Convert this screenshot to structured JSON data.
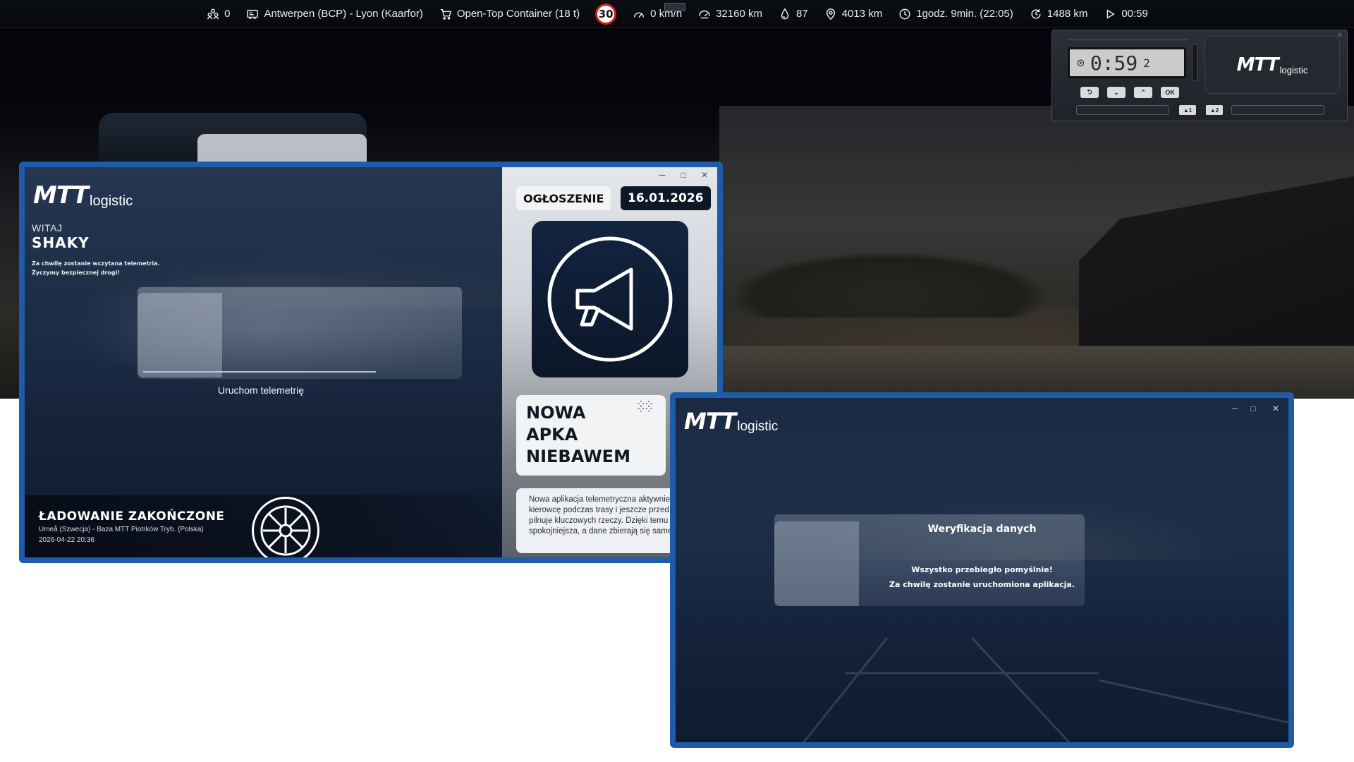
{
  "hud": {
    "convoy_count": "0",
    "route": "Antwerpen (BCP) - Lyon (Kaarfor)",
    "cargo": "Open-Top Container (18 t)",
    "speed_limit": "30",
    "speed": "0 km/h",
    "odometer": "32160 km",
    "fuel": "87",
    "distance_remaining": "4013 km",
    "eta": "1godz. 9min. (22:05)",
    "range": "1488 km",
    "play_time": "00:59"
  },
  "tachograph": {
    "time": "0:59",
    "display_suffix": "2",
    "buttons": [
      "⮌",
      "⌄",
      "⌃",
      "OK"
    ],
    "card_slots": [
      "▲1",
      "▲2"
    ],
    "logo_mtt": "MTT",
    "logo_sub": "logistic"
  },
  "launcher": {
    "logo_mtt": "MTT",
    "logo_sub": "logistic",
    "welcome_label": "WITAJ",
    "user_name": "SHAKY",
    "note_line1": "Za chwilę zostanie wczytana telemetria.",
    "note_line2": "Życzymy bezpiecznej drogi!",
    "launch_telemetry": "Uruchom telemetrię",
    "load_title": "ŁADOWANIE ZAKOŃCZONE",
    "load_route": "Umeå (Szwecja) - Baza MTT Piotrków Tryb. (Polska)",
    "load_date": "2026-04-22   20:36"
  },
  "announcement": {
    "tag": "OGŁOSZENIE",
    "date": "16.01.2026",
    "heading_line1": "NOWA",
    "heading_line2": "APKA",
    "heading_line3": "NIEBAWEM",
    "body": "Nowa aplikacja telemetryczna aktywnie wspiera kierowcę podczas trasy i jeszcze przed wyjazdem pilnuje kluczowych rzeczy. Dzięki temu jazda jest spokojniejsza, a dane zbierają się same.",
    "win_minimize": "─",
    "win_maximize": "□",
    "win_close": "✕"
  },
  "verify": {
    "logo_mtt": "MTT",
    "logo_sub": "logistic",
    "title": "Weryfikacja danych",
    "message_line1": "Wszystko przebiegło pomyślnie!",
    "message_line2": "Za chwilę zostanie uruchomiona aplikacja.",
    "win_minimize": "─",
    "win_maximize": "□",
    "win_close": "✕"
  },
  "colors": {
    "window_border": "#1e5ba8",
    "speed_limit_ring": "#d11c1c",
    "announcement_dark": "#0d1726"
  }
}
